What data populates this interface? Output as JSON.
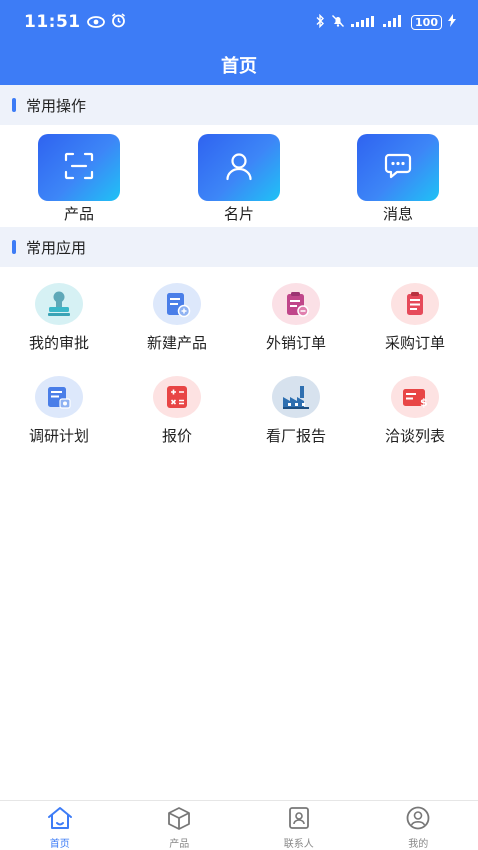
{
  "status_bar": {
    "time": "11:51",
    "battery": "100"
  },
  "header": {
    "title": "首页"
  },
  "sections": {
    "quick": {
      "title": "常用操作"
    },
    "apps": {
      "title": "常用应用"
    }
  },
  "quick_actions": [
    {
      "label": "产品",
      "icon": "scan-icon"
    },
    {
      "label": "名片",
      "icon": "user-icon"
    },
    {
      "label": "消息",
      "icon": "chat-icon"
    }
  ],
  "apps": [
    {
      "label": "我的审批",
      "icon": "stamp-icon",
      "color": "#3bb7c8"
    },
    {
      "label": "新建产品",
      "icon": "new-doc-icon",
      "color": "#4a7ee8"
    },
    {
      "label": "外销订单",
      "icon": "clipboard-icon",
      "color": "#c0468a"
    },
    {
      "label": "采购订单",
      "icon": "clipboard-list-icon",
      "color": "#e64a5a"
    },
    {
      "label": "调研计划",
      "icon": "plan-doc-icon",
      "color": "#4a7ee8"
    },
    {
      "label": "报价",
      "icon": "calculator-icon",
      "color": "#e84545"
    },
    {
      "label": "看厂报告",
      "icon": "factory-icon",
      "color": "#2e6fb0"
    },
    {
      "label": "洽谈列表",
      "icon": "dollar-card-icon",
      "color": "#e84545"
    }
  ],
  "tabbar": [
    {
      "label": "首页",
      "icon": "home-icon",
      "active": true
    },
    {
      "label": "产品",
      "icon": "cube-icon",
      "active": false
    },
    {
      "label": "联系人",
      "icon": "contacts-icon",
      "active": false
    },
    {
      "label": "我的",
      "icon": "profile-icon",
      "active": false
    }
  ],
  "colors": {
    "primary": "#3d7cf6",
    "section_bg": "#eef2fa"
  }
}
